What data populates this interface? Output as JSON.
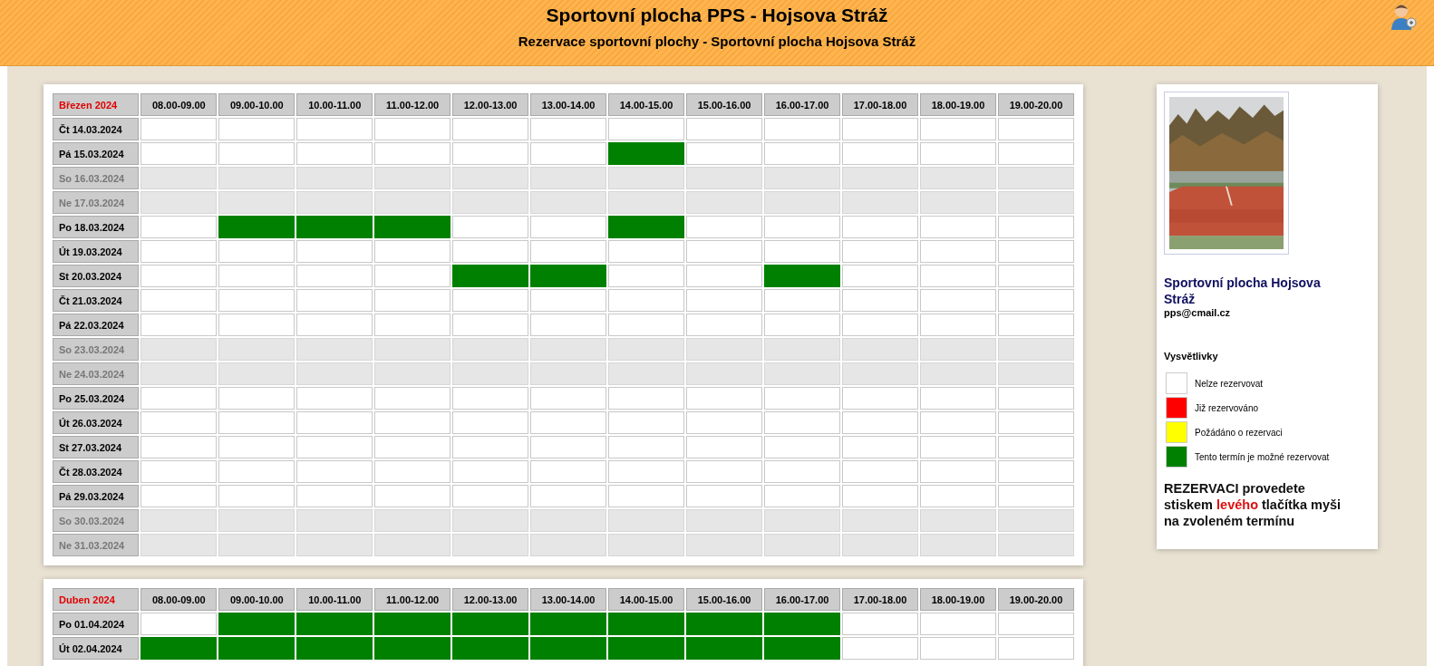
{
  "header": {
    "title": "Sportovní plocha PPS - Hojsova Stráž",
    "subtitle": "Rezervace sportovní plochy - Sportovní plocha Hojsova Stráž"
  },
  "months": [
    {
      "label": "Březen 2024",
      "columns": [
        "08.00-09.00",
        "09.00-10.00",
        "10.00-11.00",
        "11.00-12.00",
        "12.00-13.00",
        "13.00-14.00",
        "14.00-15.00",
        "15.00-16.00",
        "16.00-17.00",
        "17.00-18.00",
        "18.00-19.00",
        "19.00-20.00"
      ],
      "rows": [
        {
          "date": "Čt 14.03.2024",
          "weekend": false,
          "available": [
            false,
            false,
            false,
            false,
            false,
            false,
            false,
            false,
            false,
            false,
            false,
            false
          ]
        },
        {
          "date": "Pá 15.03.2024",
          "weekend": false,
          "available": [
            false,
            false,
            false,
            false,
            false,
            false,
            true,
            false,
            false,
            false,
            false,
            false
          ]
        },
        {
          "date": "So 16.03.2024",
          "weekend": true,
          "available": [
            false,
            false,
            false,
            false,
            false,
            false,
            false,
            false,
            false,
            false,
            false,
            false
          ]
        },
        {
          "date": "Ne 17.03.2024",
          "weekend": true,
          "available": [
            false,
            false,
            false,
            false,
            false,
            false,
            false,
            false,
            false,
            false,
            false,
            false
          ]
        },
        {
          "date": "Po 18.03.2024",
          "weekend": false,
          "available": [
            false,
            true,
            true,
            true,
            false,
            false,
            true,
            false,
            false,
            false,
            false,
            false
          ]
        },
        {
          "date": "Út 19.03.2024",
          "weekend": false,
          "available": [
            false,
            false,
            false,
            false,
            false,
            false,
            false,
            false,
            false,
            false,
            false,
            false
          ]
        },
        {
          "date": "St 20.03.2024",
          "weekend": false,
          "available": [
            false,
            false,
            false,
            false,
            true,
            true,
            false,
            false,
            true,
            false,
            false,
            false
          ]
        },
        {
          "date": "Čt 21.03.2024",
          "weekend": false,
          "available": [
            false,
            false,
            false,
            false,
            false,
            false,
            false,
            false,
            false,
            false,
            false,
            false
          ]
        },
        {
          "date": "Pá 22.03.2024",
          "weekend": false,
          "available": [
            false,
            false,
            false,
            false,
            false,
            false,
            false,
            false,
            false,
            false,
            false,
            false
          ]
        },
        {
          "date": "So 23.03.2024",
          "weekend": true,
          "available": [
            false,
            false,
            false,
            false,
            false,
            false,
            false,
            false,
            false,
            false,
            false,
            false
          ]
        },
        {
          "date": "Ne 24.03.2024",
          "weekend": true,
          "available": [
            false,
            false,
            false,
            false,
            false,
            false,
            false,
            false,
            false,
            false,
            false,
            false
          ]
        },
        {
          "date": "Po 25.03.2024",
          "weekend": false,
          "available": [
            false,
            false,
            false,
            false,
            false,
            false,
            false,
            false,
            false,
            false,
            false,
            false
          ]
        },
        {
          "date": "Út 26.03.2024",
          "weekend": false,
          "available": [
            false,
            false,
            false,
            false,
            false,
            false,
            false,
            false,
            false,
            false,
            false,
            false
          ]
        },
        {
          "date": "St 27.03.2024",
          "weekend": false,
          "available": [
            false,
            false,
            false,
            false,
            false,
            false,
            false,
            false,
            false,
            false,
            false,
            false
          ]
        },
        {
          "date": "Čt 28.03.2024",
          "weekend": false,
          "available": [
            false,
            false,
            false,
            false,
            false,
            false,
            false,
            false,
            false,
            false,
            false,
            false
          ]
        },
        {
          "date": "Pá 29.03.2024",
          "weekend": false,
          "available": [
            false,
            false,
            false,
            false,
            false,
            false,
            false,
            false,
            false,
            false,
            false,
            false
          ]
        },
        {
          "date": "So 30.03.2024",
          "weekend": true,
          "available": [
            false,
            false,
            false,
            false,
            false,
            false,
            false,
            false,
            false,
            false,
            false,
            false
          ]
        },
        {
          "date": "Ne 31.03.2024",
          "weekend": true,
          "available": [
            false,
            false,
            false,
            false,
            false,
            false,
            false,
            false,
            false,
            false,
            false,
            false
          ]
        }
      ]
    },
    {
      "label": "Duben 2024",
      "columns": [
        "08.00-09.00",
        "09.00-10.00",
        "10.00-11.00",
        "11.00-12.00",
        "12.00-13.00",
        "13.00-14.00",
        "14.00-15.00",
        "15.00-16.00",
        "16.00-17.00",
        "17.00-18.00",
        "18.00-19.00",
        "19.00-20.00"
      ],
      "rows": [
        {
          "date": "Po 01.04.2024",
          "weekend": false,
          "available": [
            false,
            true,
            true,
            true,
            true,
            true,
            true,
            true,
            true,
            false,
            false,
            false
          ]
        },
        {
          "date": "Út 02.04.2024",
          "weekend": false,
          "available": [
            true,
            true,
            true,
            true,
            true,
            true,
            true,
            true,
            true,
            false,
            false,
            false
          ]
        }
      ]
    }
  ],
  "sidebar": {
    "venue_name": "Sportovní plocha Hojsova Stráž",
    "email": "pps@cmail.cz",
    "legend_title": "Vysvětlivky",
    "legend": [
      {
        "label": "Nelze rezervovat",
        "color": "#ffffff"
      },
      {
        "label": "Již rezervováno",
        "color": "#ff0000"
      },
      {
        "label": "Požádáno o rezervaci",
        "color": "#ffff00"
      },
      {
        "label": "Tento termín je možné rezervovat",
        "color": "#008000"
      }
    ],
    "instruction": [
      {
        "text": "REZERVACI provedete stiskem ",
        "highlight": false
      },
      {
        "text": "levého",
        "highlight": true
      },
      {
        "text": " tlačítka myši na zvoleném termínu",
        "highlight": false
      }
    ]
  }
}
